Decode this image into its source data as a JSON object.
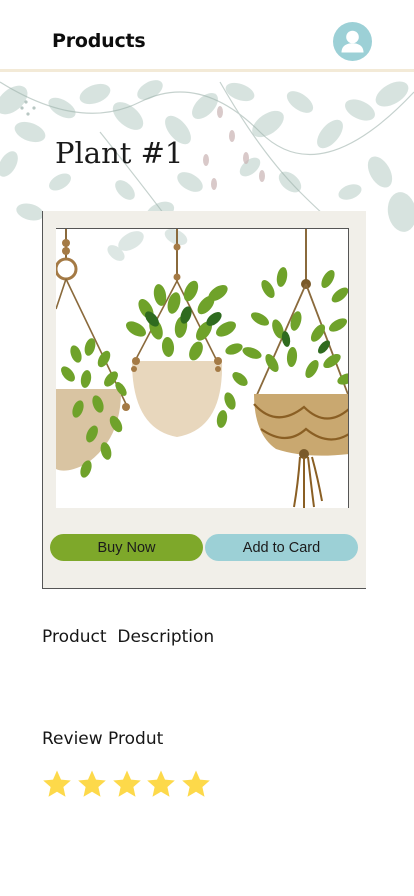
{
  "header": {
    "title": "Products",
    "avatar_icon": "user-avatar-icon",
    "avatar_color": "#9cd0d6"
  },
  "product": {
    "name": "Plant #1",
    "image": "hanging-macrame-plants-illustration"
  },
  "actions": {
    "buy_label": "Buy Now",
    "cart_label": "Add to Card",
    "buy_color": "#7ea82a",
    "cart_color": "#9cd0d6"
  },
  "sections": {
    "description_label": "Product  Description",
    "review_label": "Review Produt"
  },
  "rating": {
    "value": 5,
    "max": 5,
    "star_color": "#fdd94a",
    "star_icon": "star-icon"
  }
}
